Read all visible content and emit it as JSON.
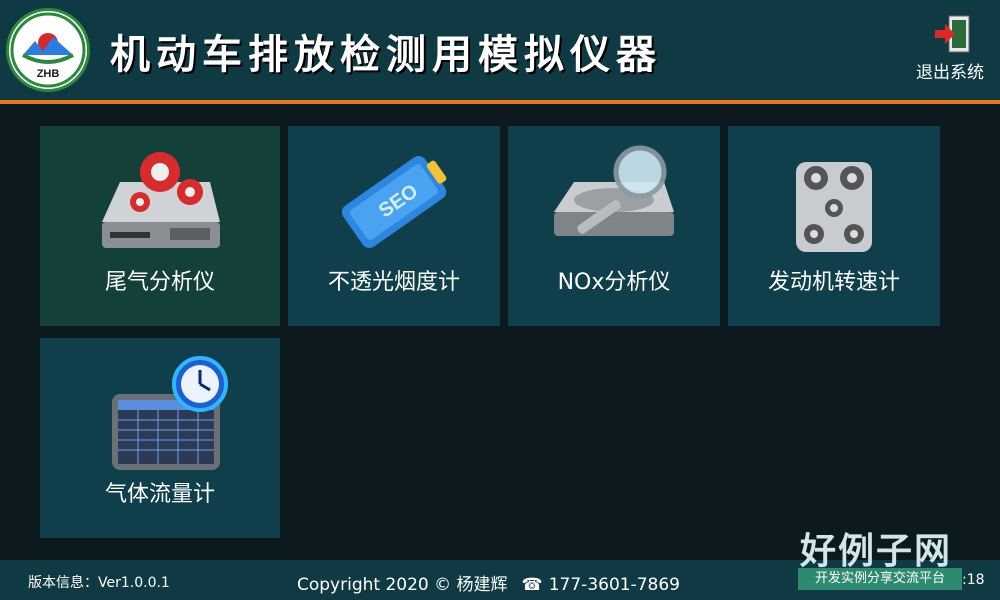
{
  "header": {
    "logo_text": "ZHB",
    "title": "机动车排放检测用模拟仪器",
    "exit_label": "退出系统"
  },
  "tiles": [
    {
      "label": "尾气分析仪",
      "icon": "gear-harddrive-icon"
    },
    {
      "label": "不透光烟度计",
      "icon": "seo-battery-icon"
    },
    {
      "label": "NOx分析仪",
      "icon": "magnifier-drive-icon"
    },
    {
      "label": "发动机转速计",
      "icon": "engine-belt-icon"
    },
    {
      "label": "气体流量计",
      "icon": "spreadsheet-clock-icon"
    }
  ],
  "footer": {
    "version": "版本信息：Ver1.0.0.1",
    "copyright": "Copyright 2020 © 杨建辉",
    "phone": "177-3601-7869",
    "time_fragment": ":18"
  },
  "watermark": {
    "big": "好例子网",
    "small": "开发实例分享交流平台"
  },
  "colors": {
    "header_bg": "#0f3a44",
    "accent_line": "#e8781a",
    "tile_bg": "#0f3f4a",
    "body_bg": "#0c1a1f"
  }
}
